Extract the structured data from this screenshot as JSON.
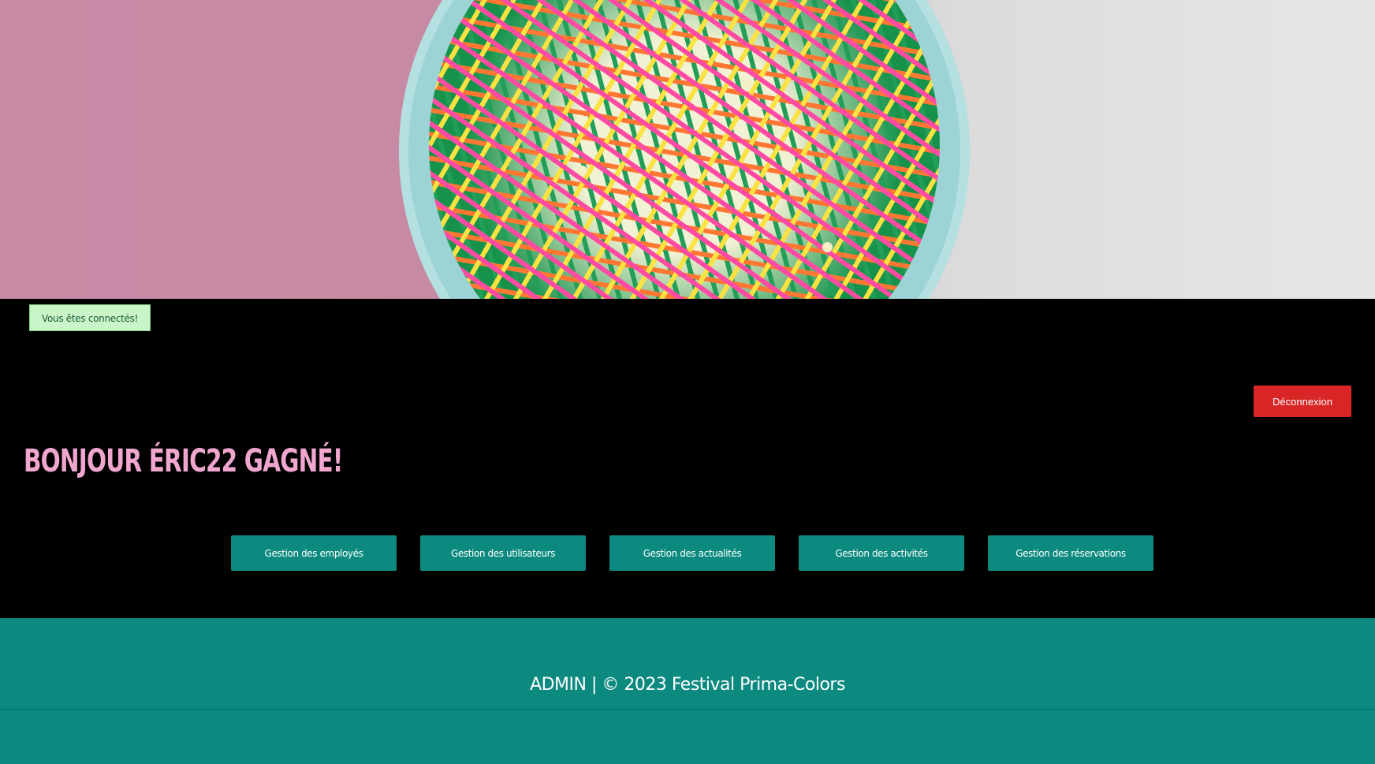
{
  "alert": {
    "text": "Vous êtes connectés!"
  },
  "header": {
    "logout_label": "Déconnexion"
  },
  "main": {
    "greeting": "BONJOUR ÉRIC22 GAGNÉ!",
    "buttons": [
      {
        "label": "Gestion des employés"
      },
      {
        "label": "Gestion des utilisateurs"
      },
      {
        "label": "Gestion des actualités"
      },
      {
        "label": "Gestion des activités"
      },
      {
        "label": "Gestion des réservations"
      }
    ]
  },
  "footer": {
    "text": "ADMIN | © 2023 Festival Prima-Colors"
  },
  "colors": {
    "background": "#000000",
    "accent_teal": "#0c8a80",
    "greeting_pink": "#f0a6cf",
    "logout_red": "#d92525",
    "alert_green": "#c9f5c9"
  }
}
